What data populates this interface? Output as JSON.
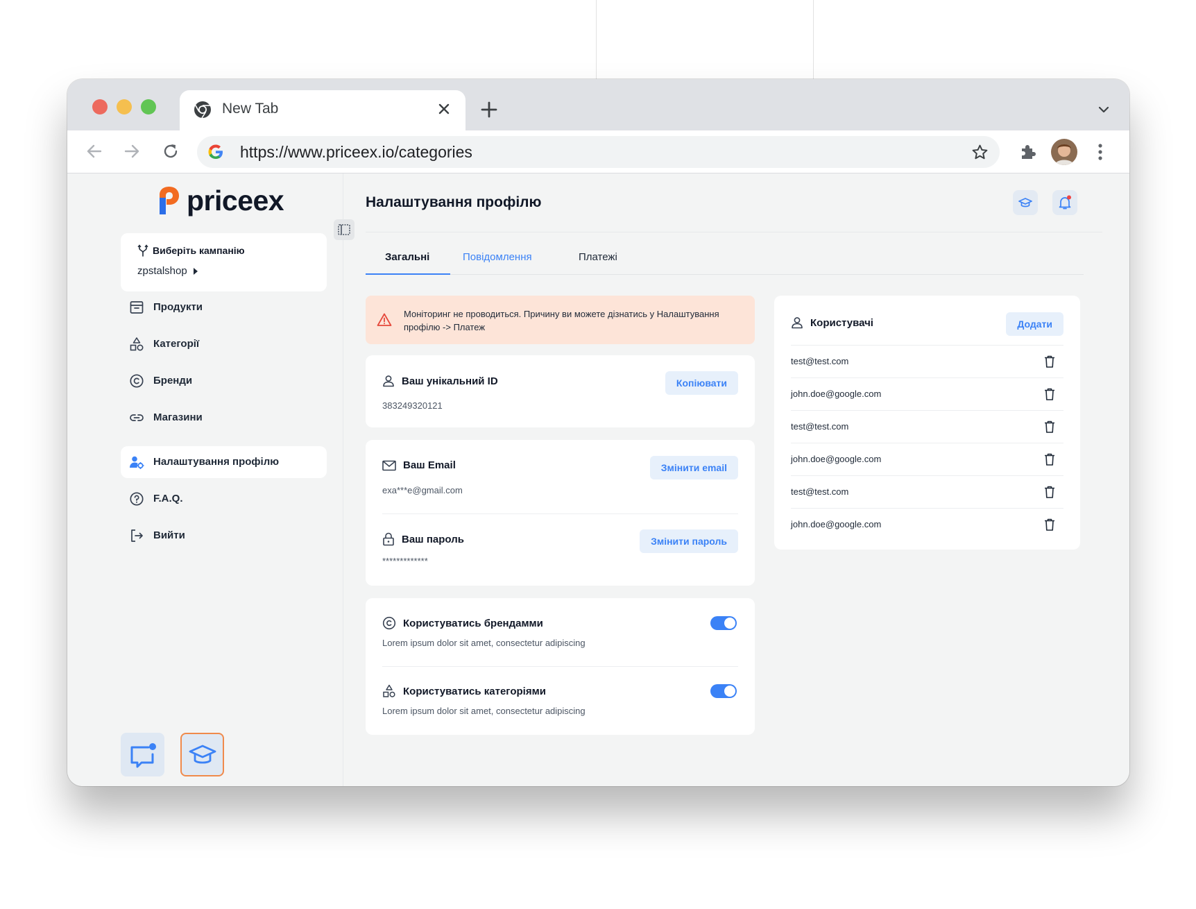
{
  "browser": {
    "tab_title": "New Tab",
    "url": "https://www.priceex.io/categories"
  },
  "sidebar": {
    "brand": "priceex",
    "campaign": {
      "label": "Виберіть кампанію",
      "value": "zpstalshop"
    },
    "items": [
      {
        "label": "Продукти",
        "icon": "archive-icon"
      },
      {
        "label": "Категорії",
        "icon": "shapes-icon"
      },
      {
        "label": "Бренди",
        "icon": "copyright-icon"
      },
      {
        "label": "Магазини",
        "icon": "link-icon"
      },
      {
        "label": "Налаштування профілю",
        "icon": "user-settings-icon",
        "active": true
      },
      {
        "label": "F.A.Q.",
        "icon": "question-icon"
      },
      {
        "label": "Вийти",
        "icon": "logout-icon"
      }
    ]
  },
  "main": {
    "title": "Налаштування профілю",
    "tabs": [
      {
        "label": "Загальні",
        "active": true
      },
      {
        "label": "Повідомлення"
      },
      {
        "label": "Платежі"
      }
    ],
    "alert": "Моніторинг не проводиться. Причину ви можете дізнатись у Налаштування профілю -> Платеж",
    "unique_id": {
      "label": "Ваш унікальний ID",
      "value": "383249320121",
      "button": "Копіювати"
    },
    "email": {
      "label": "Ваш Email",
      "value": "exa***e@gmail.com",
      "button": "Змінити email"
    },
    "password": {
      "label": "Ваш пароль",
      "value": "*************",
      "button": "Змінити пароль"
    },
    "toggles": [
      {
        "label": "Користуватись брендамми",
        "desc": "Lorem ipsum dolor sit amet, consectetur adipiscing",
        "on": true
      },
      {
        "label": "Користуватись категоріями",
        "desc": "Lorem ipsum dolor sit amet, consectetur adipiscing",
        "on": true
      }
    ],
    "users": {
      "title": "Користувачі",
      "add_button": "Додати",
      "list": [
        "test@test.com",
        "john.doe@google.com",
        "test@test.com",
        "john.doe@google.com",
        "test@test.com",
        "john.doe@google.com"
      ]
    }
  },
  "colors": {
    "accent": "#3b82f6",
    "alert_bg": "#fde4d8",
    "brand_orange": "#f26b21",
    "brand_blue": "#2b6ee8"
  }
}
